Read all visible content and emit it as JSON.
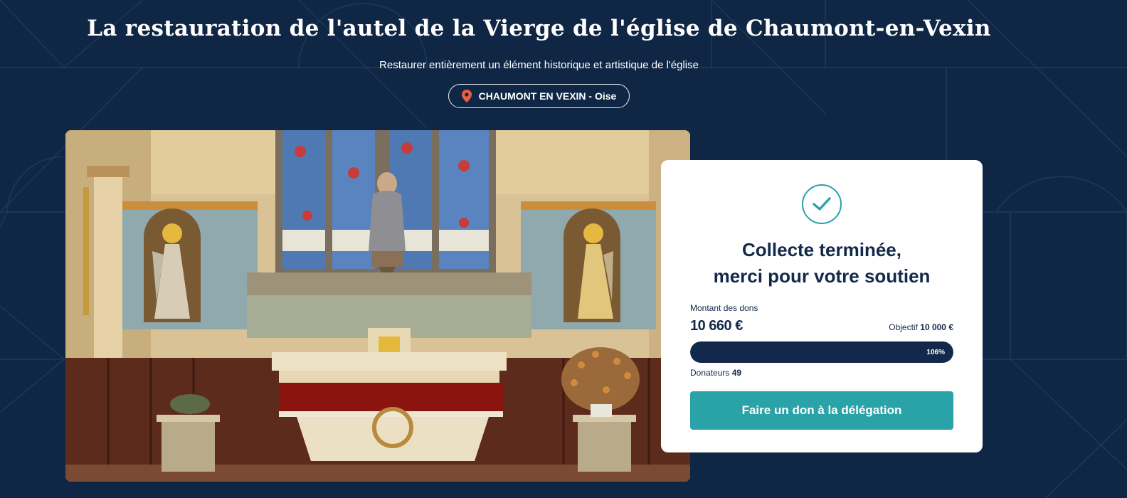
{
  "page": {
    "title": "La restauration de l'autel de la Vierge de l'église de Chaumont-en-Vexin",
    "subtitle": "Restaurer entièrement un élément historique et artistique de l'église",
    "location": "CHAUMONT EN VEXIN - Oise",
    "location_icon": "map-pin-icon"
  },
  "colors": {
    "background": "#0f2644",
    "accent": "#2aa3a8",
    "navy": "#13294b",
    "pin": "#e8613c"
  },
  "campaign": {
    "status_icon": "check-icon",
    "status_line1": "Collecte terminée,",
    "status_line2": "merci pour votre soutien",
    "amount_label": "Montant des dons",
    "amount_value": "10 660 €",
    "goal_label": "Objectif",
    "goal_value": "10 000 €",
    "progress_percent": 106,
    "progress_label": "106%",
    "donors_label": "Donateurs",
    "donors_count": "49",
    "donate_button": "Faire un don à la délégation"
  }
}
